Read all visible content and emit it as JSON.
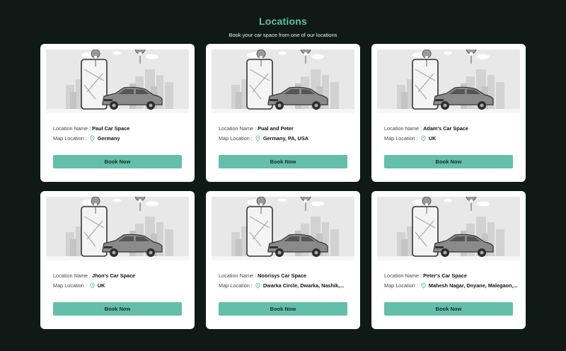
{
  "header": {
    "title": "Locations",
    "subtitle": "Book your car space from one of our locations"
  },
  "labels": {
    "location_name": "Location Name :",
    "map_location": "Map Location :"
  },
  "locations": [
    {
      "name": "Paul Car Space",
      "map": "Germany",
      "button": "Book Now"
    },
    {
      "name": "Pual and Peter",
      "map": "Germany, PA, USA",
      "button": "Book Now"
    },
    {
      "name": "Adam's Car Space",
      "map": "UK",
      "button": "Book Now"
    },
    {
      "name": "Jhon's Car Space",
      "map": "UK",
      "button": "Book Now"
    },
    {
      "name": "Noorisys Car Space",
      "map": "Dwarka Circle, Dwarka, Nashik,...",
      "button": "Book Now"
    },
    {
      "name": "Peter's Car Space",
      "map": "Mahesh Nagar, Dnyane, Malegaon,...",
      "button": "Book Now"
    }
  ],
  "icons": {
    "card_image": "car-parking-illustration-icon",
    "map_pin": "map-pin-icon"
  },
  "colors": {
    "background": "#0f1a17",
    "accent": "#63bfa9",
    "card": "#ffffff"
  }
}
